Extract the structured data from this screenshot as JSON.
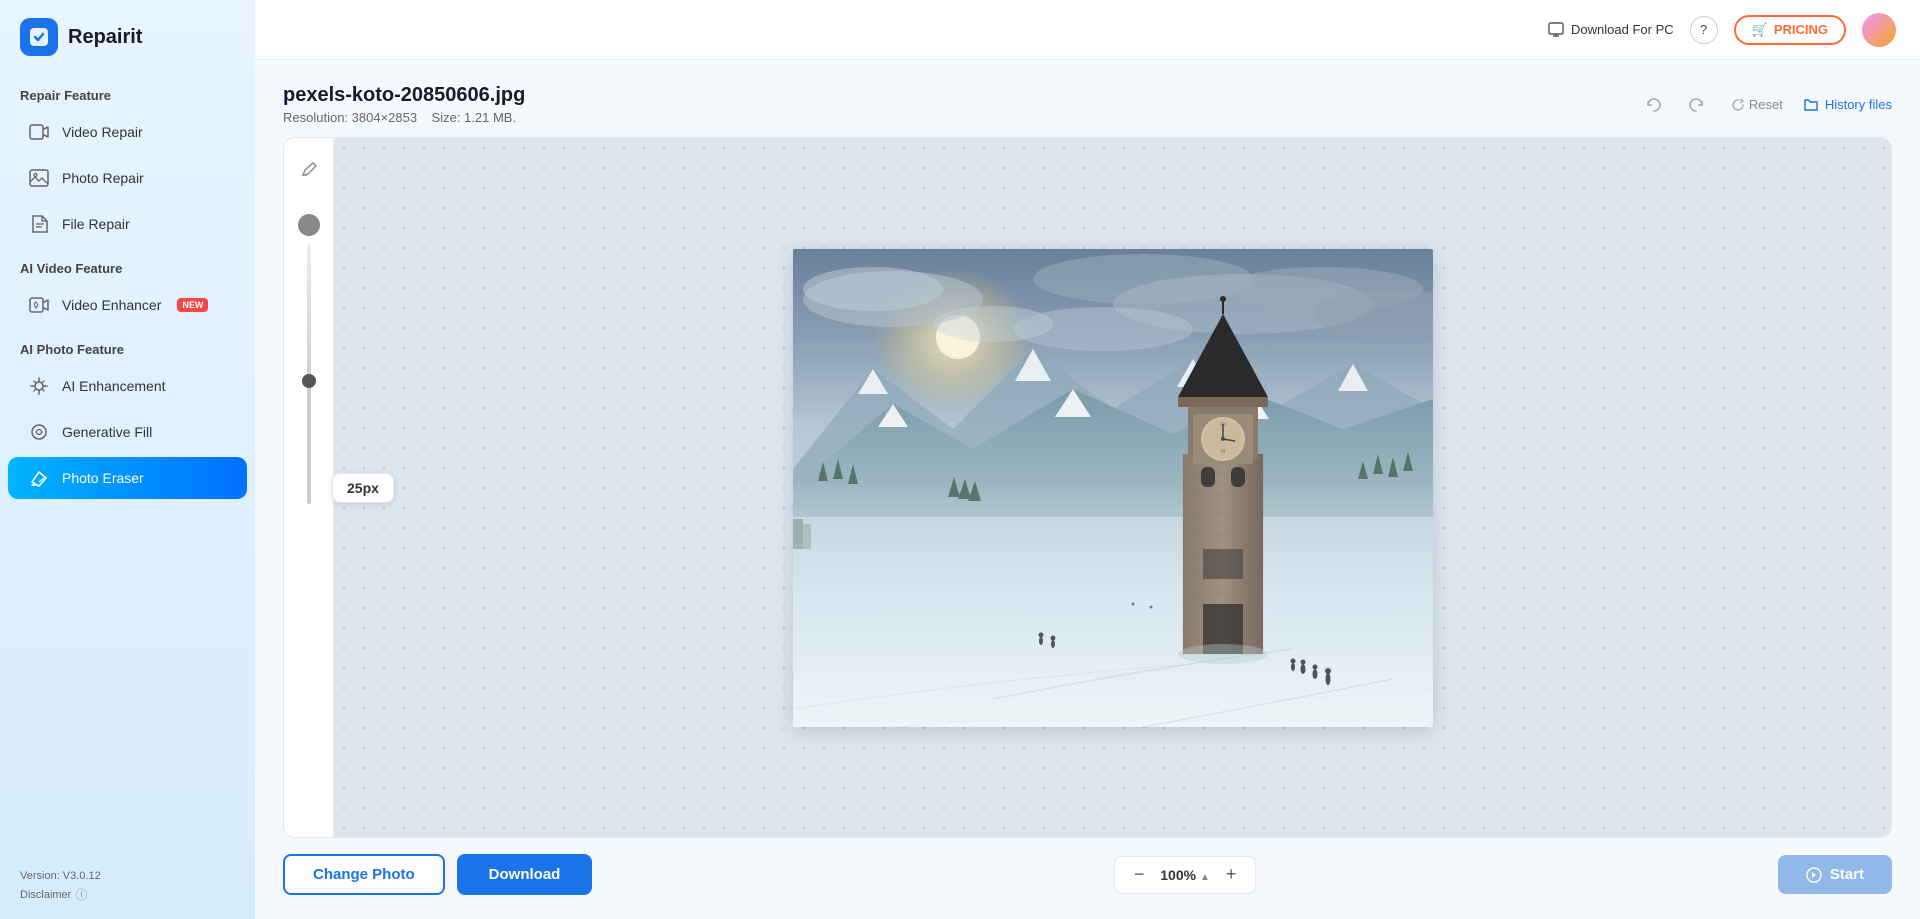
{
  "app": {
    "name": "Repairit",
    "logo_icon": "R"
  },
  "topbar": {
    "download_pc_label": "Download For PC",
    "pricing_label": "PRICING",
    "cart_icon": "🛒"
  },
  "sidebar": {
    "section1_label": "Repair Feature",
    "items_repair": [
      {
        "id": "video-repair",
        "label": "Video Repair",
        "icon": "▶"
      },
      {
        "id": "photo-repair",
        "label": "Photo Repair",
        "icon": "🖼"
      },
      {
        "id": "file-repair",
        "label": "File Repair",
        "icon": "📄"
      }
    ],
    "section2_label": "AI Video Feature",
    "items_ai_video": [
      {
        "id": "video-enhancer",
        "label": "Video Enhancer",
        "icon": "✨",
        "badge": "NEW"
      }
    ],
    "section3_label": "AI Photo Feature",
    "items_ai_photo": [
      {
        "id": "ai-enhancement",
        "label": "AI Enhancement",
        "icon": "✨"
      },
      {
        "id": "generative-fill",
        "label": "Generative Fill",
        "icon": "🎨"
      },
      {
        "id": "photo-eraser",
        "label": "Photo Eraser",
        "icon": "✏",
        "active": true
      }
    ],
    "version": "Version: V3.0.12",
    "disclaimer": "Disclaimer"
  },
  "file": {
    "name": "pexels-koto-20850606.jpg",
    "resolution": "Resolution: 3804×2853",
    "size": "Size: 1.21 MB."
  },
  "toolbar": {
    "undo_label": "↩",
    "redo_label": "↪",
    "reset_label": "Reset",
    "history_label": "History files"
  },
  "brush": {
    "size_px": "25px",
    "tooltip_label": "25px"
  },
  "zoom": {
    "value": "100%",
    "minus_label": "−",
    "plus_label": "+"
  },
  "actions": {
    "change_photo": "Change Photo",
    "download": "Download",
    "start": "Start"
  }
}
